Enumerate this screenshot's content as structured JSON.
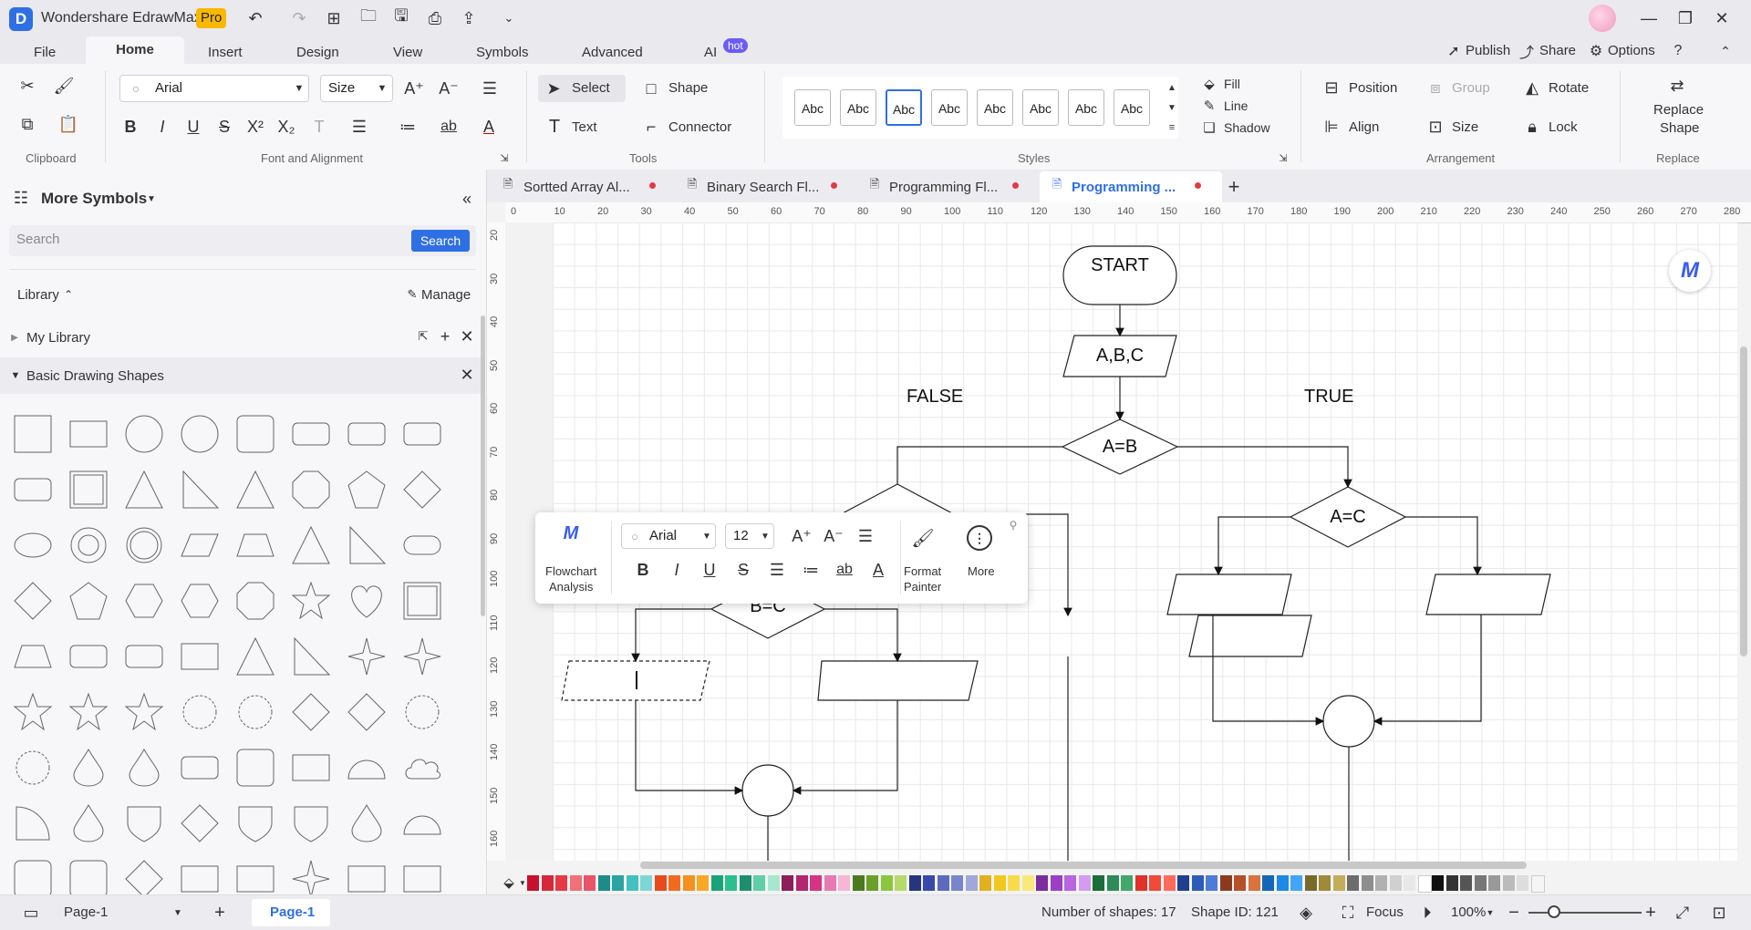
{
  "app": {
    "name": "Wondershare EdrawMax",
    "badge": "Pro"
  },
  "menu": {
    "tabs": [
      "File",
      "Home",
      "Insert",
      "Design",
      "View",
      "Symbols",
      "Advanced",
      "AI"
    ],
    "ai_badge": "hot",
    "publish": "Publish",
    "share": "Share",
    "options": "Options"
  },
  "ribbon": {
    "font": "Arial",
    "size": "Size",
    "select": "Select",
    "shape": "Shape",
    "text": "Text",
    "connector": "Connector",
    "style_label": "Abc",
    "fill": "Fill",
    "line": "Line",
    "shadow": "Shadow",
    "position": "Position",
    "group": "Group",
    "rotate": "Rotate",
    "align": "Align",
    "lock": "Lock",
    "replace_shape_1": "Replace",
    "replace_shape_2": "Shape",
    "groups": {
      "clipboard": "Clipboard",
      "font": "Font and Alignment",
      "tools": "Tools",
      "styles": "Styles",
      "arrangement": "Arrangement",
      "replace": "Replace"
    }
  },
  "sidebar": {
    "title": "More Symbols",
    "search_placeholder": "Search",
    "search_button": "Search",
    "library": "Library",
    "manage": "Manage",
    "my_library": "My Library",
    "basic_shapes": "Basic Drawing Shapes"
  },
  "doc_tabs": [
    "Sortted Array Al...",
    "Binary Search Fl...",
    "Programming Fl...",
    "Programming ..."
  ],
  "ruler": {
    "h": [
      "0",
      "10",
      "20",
      "30",
      "40",
      "50",
      "60",
      "70",
      "80",
      "90",
      "100",
      "110",
      "120",
      "130",
      "140",
      "150",
      "160",
      "170",
      "180",
      "190",
      "200",
      "210",
      "220",
      "230",
      "240",
      "250",
      "260",
      "270",
      "280"
    ],
    "v": [
      "20",
      "30",
      "40",
      "50",
      "60",
      "70",
      "80",
      "90",
      "100",
      "110",
      "120",
      "130",
      "140",
      "150",
      "160"
    ]
  },
  "flow": {
    "start": "START",
    "input": "A,B,C",
    "cond1": "A=B",
    "cond2": "A=C",
    "cond3": "B=C",
    "cond_partial": "A=C",
    "false_label": "FALSE",
    "true_label": "TRUE"
  },
  "floatbar": {
    "analysis_1": "Flowchart",
    "analysis_2": "Analysis",
    "font": "Arial",
    "size": "12",
    "painter_1": "Format",
    "painter_2": "Painter",
    "more": "More"
  },
  "status": {
    "page_select": "Page-1",
    "page_tab": "Page-1",
    "shapes": "Number of shapes: 17",
    "shape_id": "Shape ID: 121",
    "focus": "Focus",
    "zoom": "100%"
  },
  "colors": {
    "accent": "#2f6fe4",
    "palette": [
      "#c8102e",
      "#d62839",
      "#e63946",
      "#f07178",
      "#e9546b",
      "#1f8a8a",
      "#2ba3a3",
      "#43c1c1",
      "#7fd6d6",
      "#e84a1b",
      "#f26b1d",
      "#f58f1e",
      "#f9a825",
      "#1aa37a",
      "#2bbf8f",
      "#1e8f6e",
      "#5fcfa6",
      "#a8e6cf",
      "#8e1d5b",
      "#b3256e",
      "#d63384",
      "#e67ab3",
      "#f5b7d3",
      "#4a7a1f",
      "#6a9f2a",
      "#8cc63f",
      "#b5d96b",
      "#27357e",
      "#3949ab",
      "#5c6bc0",
      "#7986cb",
      "#9fa8da",
      "#e0b020",
      "#f2c81e",
      "#f7dc4a",
      "#fbe87a",
      "#7b2c9e",
      "#9c3fc4",
      "#b865e0",
      "#d49cf0",
      "#1b6e3a",
      "#2e8b57",
      "#43a66b",
      "#e0312b",
      "#f04a3a",
      "#ff6b5a",
      "#1f3f8f",
      "#2d5bb8",
      "#4d7bd6",
      "#8b3a1e",
      "#b5502b",
      "#d9733f",
      "#1366b8",
      "#1e88e5",
      "#42a5f5",
      "#7a6a2a",
      "#9e8a3a",
      "#c4ad5a",
      "#6d6d6d",
      "#8e8e8e",
      "#b0b0b0",
      "#d0d0d0",
      "#e8e8e8",
      "#ffffff",
      "#111111",
      "#333333",
      "#555555",
      "#777777",
      "#999999",
      "#bbbbbb",
      "#dddddd",
      "#f5f5f5"
    ]
  }
}
